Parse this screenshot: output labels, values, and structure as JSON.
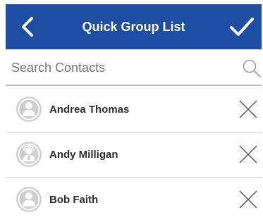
{
  "header": {
    "title": "Quick Group List",
    "back_icon": "chevron-left-icon",
    "confirm_icon": "checkmark-icon",
    "background_color": "#1d4ea3"
  },
  "search": {
    "placeholder": "Search Contacts",
    "value": "",
    "icon": "search-icon"
  },
  "contacts": [
    {
      "name": "Andrea Thomas",
      "avatar": "person-avatar-icon",
      "remove_icon": "close-icon"
    },
    {
      "name": "Andy Milligan",
      "avatar": "person-headset-avatar-icon",
      "remove_icon": "close-icon"
    },
    {
      "name": "Bob Faith",
      "avatar": "person-avatar-icon",
      "remove_icon": "close-icon"
    }
  ]
}
